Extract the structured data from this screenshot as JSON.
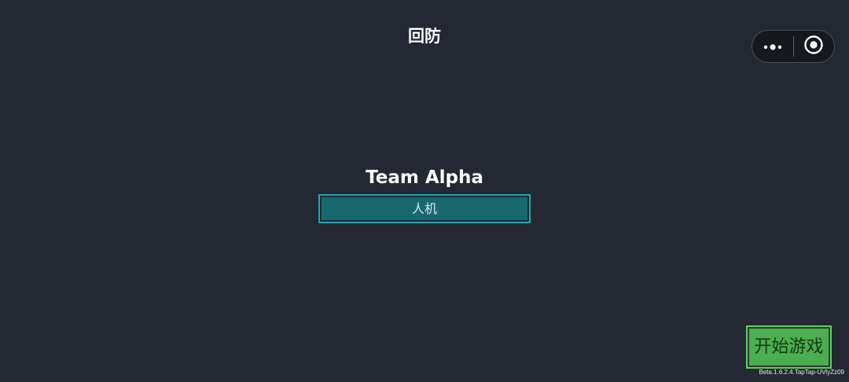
{
  "header": {
    "title": "回防"
  },
  "capsule": {
    "more_icon": "more-dots-icon",
    "close_icon": "target-circle-icon"
  },
  "team": {
    "name": "Team Alpha",
    "mode_label": "人机"
  },
  "actions": {
    "start_label": "开始游戏"
  },
  "footer": {
    "version": "Beta.1.6.2.4.TapTap-UVlyZz09"
  },
  "colors": {
    "background": "#232832",
    "mode_border": "#1aa7b1",
    "mode_fill": "#17696f",
    "start_border": "#5cd062",
    "start_fill": "#4cae4f"
  }
}
